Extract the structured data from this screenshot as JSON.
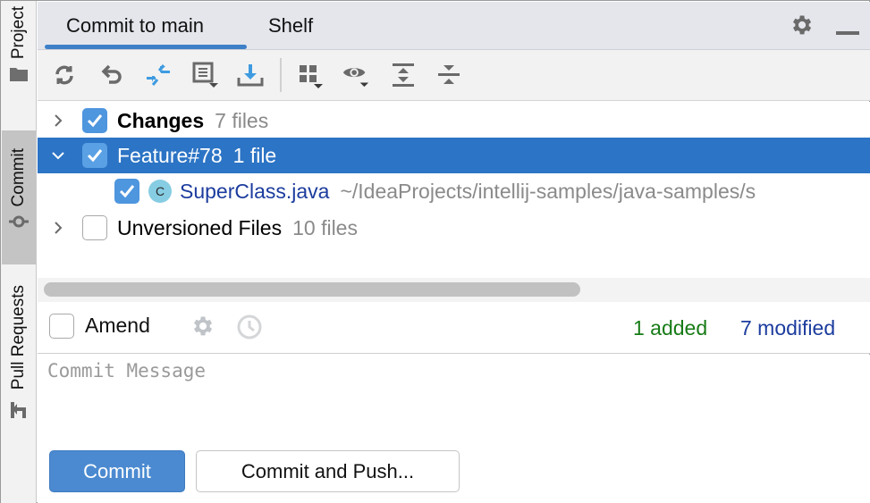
{
  "tool_window_stripe": {
    "buttons": [
      {
        "label": "Project",
        "icon": "folder-icon",
        "active": false
      },
      {
        "label": "Commit",
        "icon": "commit-node-icon",
        "active": true
      },
      {
        "label": "Pull Requests",
        "icon": "pull-request-icon",
        "active": false
      }
    ]
  },
  "header": {
    "tabs": [
      {
        "label": "Commit to main",
        "active": true
      },
      {
        "label": "Shelf",
        "active": false
      }
    ],
    "icons": [
      "gear-icon",
      "minimize-icon"
    ]
  },
  "toolbar": {
    "buttons": [
      {
        "name": "refresh",
        "icon": "refresh-icon",
        "tooltip": "Refresh"
      },
      {
        "name": "rollback",
        "icon": "rollback-icon",
        "tooltip": "Rollback"
      },
      {
        "name": "show-diff",
        "icon": "diff-icon",
        "tooltip": "Show Diff"
      },
      {
        "name": "changelist",
        "icon": "changelist-icon",
        "tooltip": "Changelist"
      },
      {
        "name": "update",
        "icon": "download-icon",
        "tooltip": "Update"
      },
      {
        "name": "group-by",
        "icon": "group-by-icon",
        "tooltip": "Group By"
      },
      {
        "name": "view-options",
        "icon": "eye-icon",
        "tooltip": "View Options"
      },
      {
        "name": "expand-all",
        "icon": "expand-all-icon",
        "tooltip": "Expand All"
      },
      {
        "name": "collapse-all",
        "icon": "collapse-all-icon",
        "tooltip": "Collapse All"
      }
    ]
  },
  "tree": {
    "rows": [
      {
        "label": "Changes",
        "count": "7 files",
        "checked": true,
        "expanded": false,
        "bold": true,
        "selected": false
      },
      {
        "label": "Feature#78",
        "count": "1 file",
        "checked": true,
        "expanded": true,
        "bold": false,
        "selected": true
      },
      {
        "label": "SuperClass.java",
        "path": "~/IdeaProjects/intellij-samples/java-samples/s",
        "checked": true,
        "file_icon_letter": "C"
      },
      {
        "label": "Unversioned Files",
        "count": "10 files",
        "checked": false,
        "expanded": false,
        "bold": false,
        "selected": false
      }
    ]
  },
  "amend": {
    "label": "Amend",
    "checked": false,
    "stats": {
      "added": "1 added",
      "modified": "7 modified"
    },
    "colors": {
      "added": "#177b16",
      "modified": "#1c3c9e"
    }
  },
  "commit_message": {
    "placeholder": "Commit Message",
    "value": ""
  },
  "actions": {
    "commit_label": "Commit",
    "commit_and_push_label": "Commit and Push..."
  },
  "colors": {
    "accent": "#3d80c8",
    "selection": "#2c74c5",
    "checkbox": "#4e96de",
    "primary_button": "#4b8ad0"
  }
}
